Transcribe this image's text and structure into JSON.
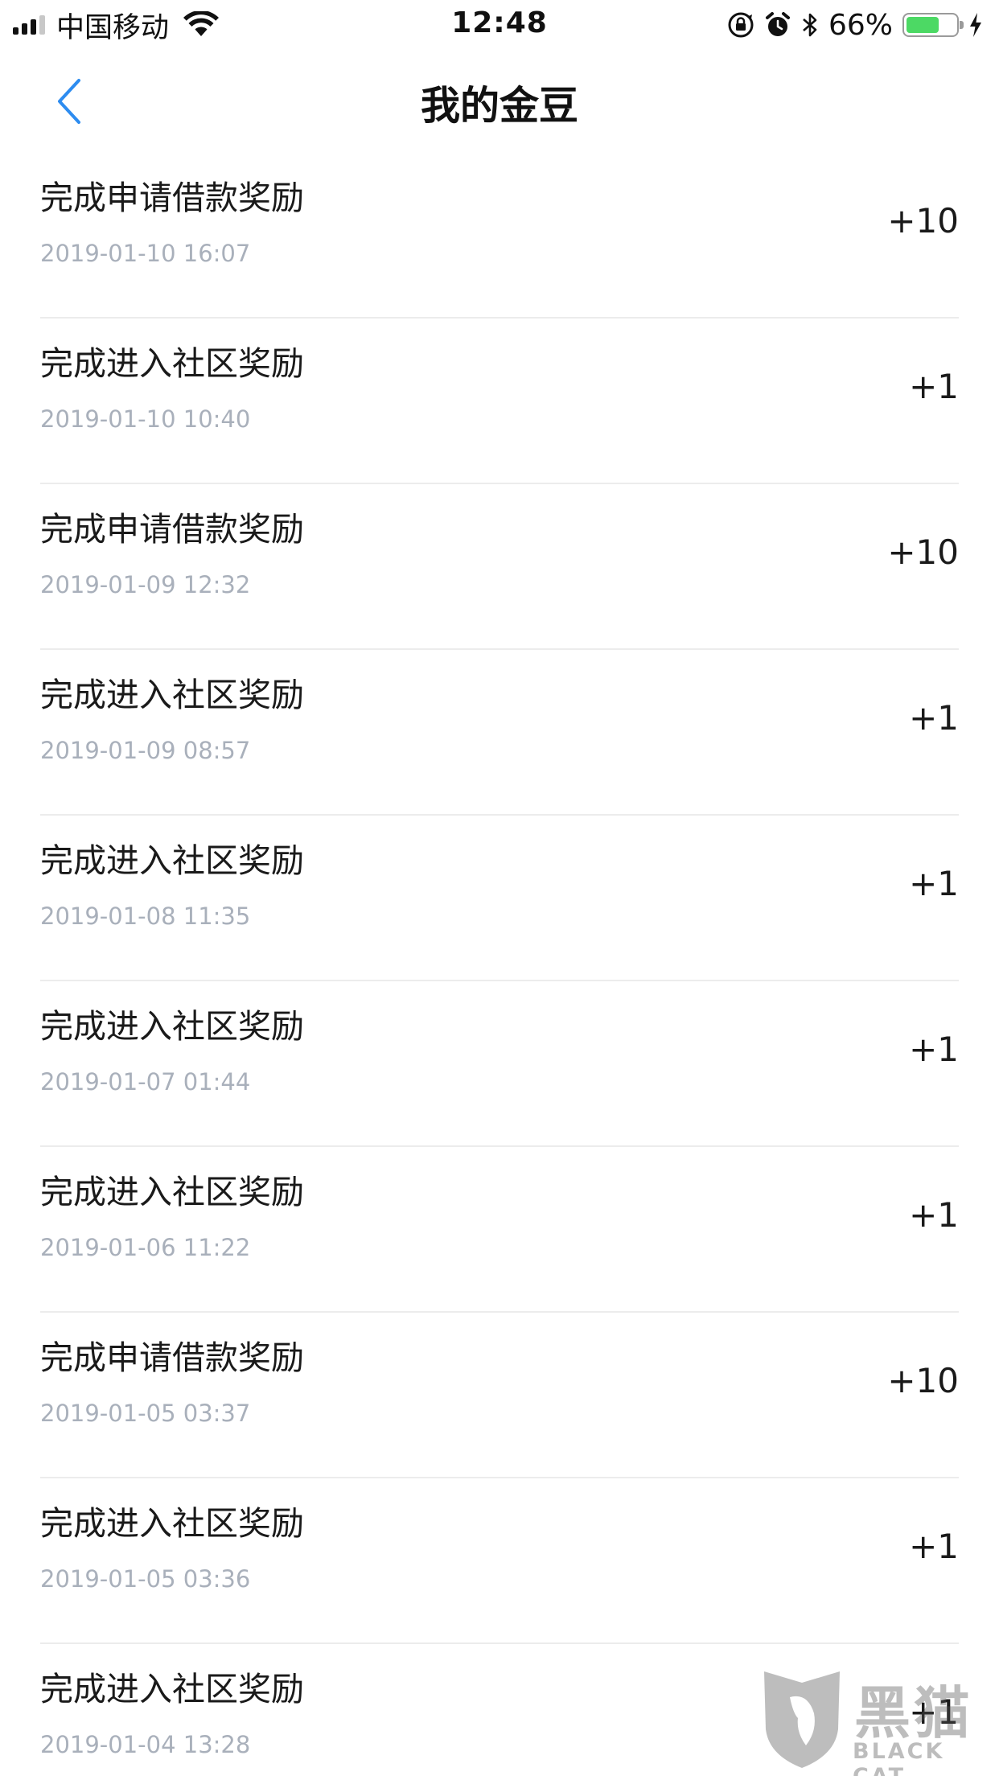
{
  "status_bar": {
    "carrier": "中国移动",
    "time": "12:48",
    "battery_percent": "66%",
    "battery_level": 0.66,
    "icons": [
      "signal-icon",
      "wifi-icon",
      "orientation-lock-icon",
      "alarm-icon",
      "bluetooth-icon",
      "battery-icon",
      "charging-icon"
    ],
    "battery_color": "#4cd964"
  },
  "nav": {
    "title": "我的金豆",
    "back_icon": "chevron-left-icon",
    "accent_color": "#2d8cf0"
  },
  "records": [
    {
      "title": "完成申请借款奖励",
      "time": "2019-01-10 16:07",
      "points": "+10"
    },
    {
      "title": "完成进入社区奖励",
      "time": "2019-01-10 10:40",
      "points": "+1"
    },
    {
      "title": "完成申请借款奖励",
      "time": "2019-01-09 12:32",
      "points": "+10"
    },
    {
      "title": "完成进入社区奖励",
      "time": "2019-01-09 08:57",
      "points": "+1"
    },
    {
      "title": "完成进入社区奖励",
      "time": "2019-01-08 11:35",
      "points": "+1"
    },
    {
      "title": "完成进入社区奖励",
      "time": "2019-01-07 01:44",
      "points": "+1"
    },
    {
      "title": "完成进入社区奖励",
      "time": "2019-01-06 11:22",
      "points": "+1"
    },
    {
      "title": "完成申请借款奖励",
      "time": "2019-01-05 03:37",
      "points": "+10"
    },
    {
      "title": "完成进入社区奖励",
      "time": "2019-01-05 03:36",
      "points": "+1"
    },
    {
      "title": "完成进入社区奖励",
      "time": "2019-01-04 13:28",
      "points": "+1"
    }
  ],
  "watermark": {
    "name": "黑猫",
    "sub": "BLACK CAT"
  }
}
